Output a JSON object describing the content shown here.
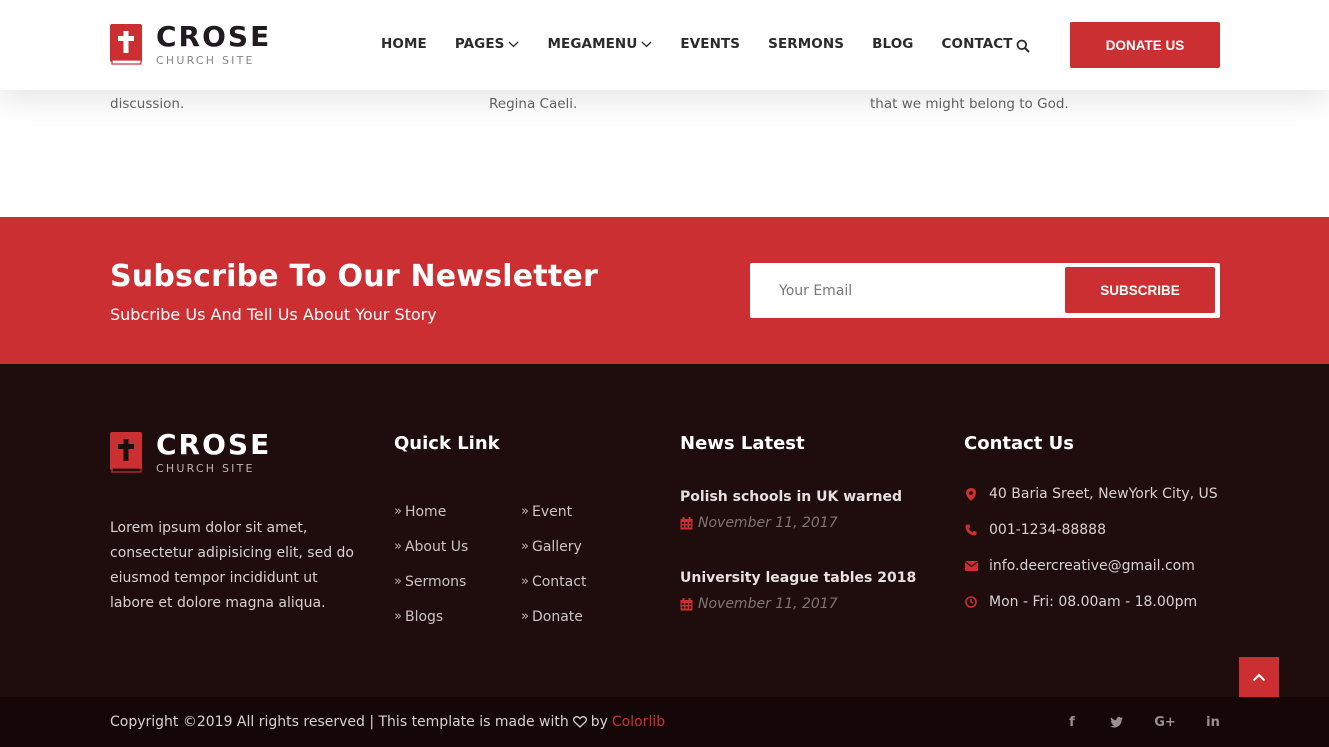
{
  "brand": {
    "name": "CROSE",
    "tagline": "CHURCH SITE",
    "accent": "#cc2f32"
  },
  "top_strip": {
    "snippets": [
      "discussion.",
      "Regina Caeli.",
      "that we might belong to God."
    ]
  },
  "header": {
    "nav": [
      {
        "label": "HOME",
        "dropdown": false
      },
      {
        "label": "PAGES",
        "dropdown": true
      },
      {
        "label": "MEGAMENU",
        "dropdown": true
      },
      {
        "label": "EVENTS",
        "dropdown": false
      },
      {
        "label": "SERMONS",
        "dropdown": false
      },
      {
        "label": "BLOG",
        "dropdown": false
      },
      {
        "label": "CONTACT",
        "dropdown": false
      }
    ],
    "search_icon": "search-icon",
    "donate_label": "DONATE US"
  },
  "newsletter": {
    "title": "Subscribe To Our Newsletter",
    "subtitle": "Subcribe Us And Tell Us About Your Story",
    "email_placeholder": "Your Email",
    "email_value": "",
    "button_label": "SUBSCRIBE"
  },
  "footer": {
    "about": "Lorem ipsum dolor sit amet, consectetur adipisicing elit, sed do eiusmod tempor incididunt ut labore et dolore magna aliqua.",
    "quick_link": {
      "title": "Quick Link",
      "col1": [
        "Home",
        "About Us",
        "Sermons",
        "Blogs"
      ],
      "col2": [
        "Event",
        "Gallery",
        "Contact",
        "Donate"
      ]
    },
    "news": {
      "title": "News Latest",
      "items": [
        {
          "title": "Polish schools in UK warned",
          "date": "November 11, 2017"
        },
        {
          "title": "University league tables 2018",
          "date": "November 11, 2017"
        }
      ]
    },
    "contact": {
      "title": "Contact Us",
      "address": "40 Baria Sreet, NewYork City, US",
      "phone": "001-1234-88888",
      "email": "info.deercreative@gmail.com",
      "hours": "Mon - Fri: 08.00am - 18.00pm"
    },
    "copyright": {
      "prefix": "Copyright ©2019 All rights reserved | This template is made with",
      "by": "by",
      "author": "Colorlib"
    },
    "social": [
      "f",
      "t",
      "G+",
      "in"
    ]
  }
}
